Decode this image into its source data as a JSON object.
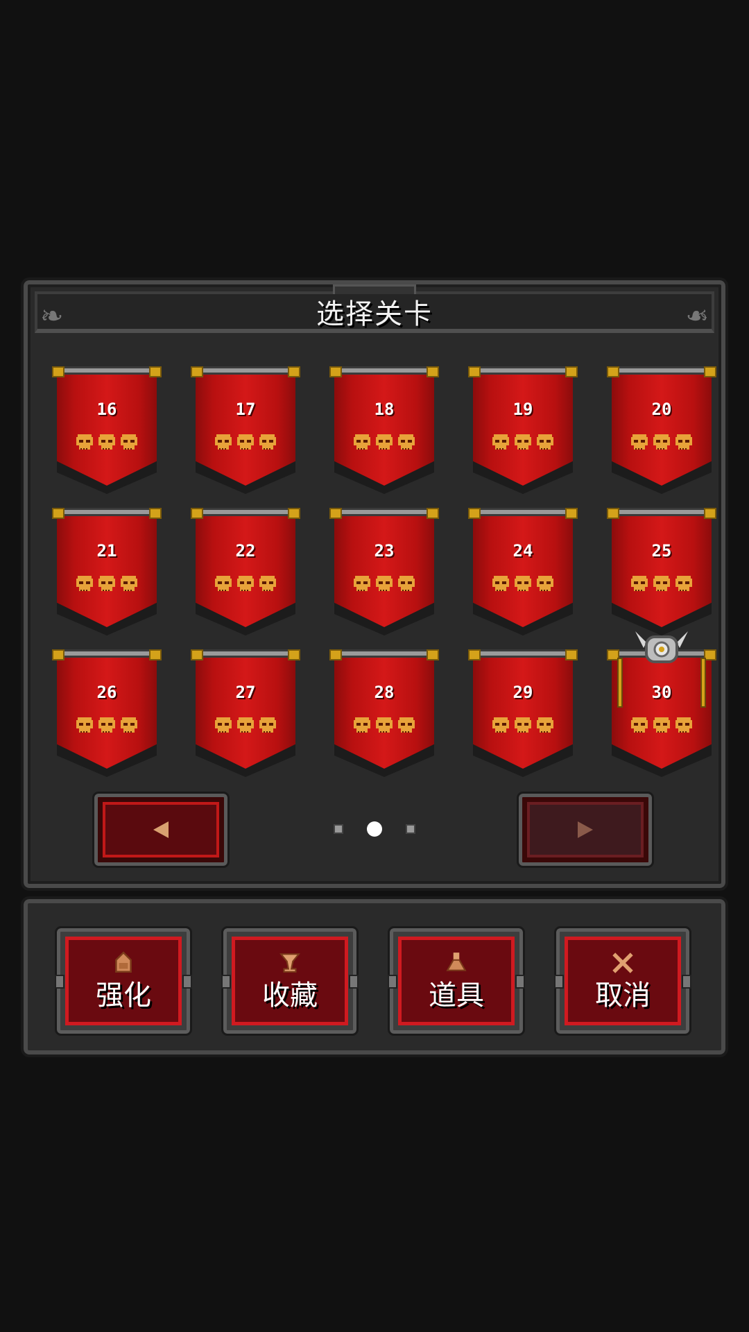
{
  "title": "选择关卡",
  "levels": [
    {
      "number": "16",
      "skulls": 3,
      "boss": false
    },
    {
      "number": "17",
      "skulls": 3,
      "boss": false
    },
    {
      "number": "18",
      "skulls": 3,
      "boss": false
    },
    {
      "number": "19",
      "skulls": 3,
      "boss": false
    },
    {
      "number": "20",
      "skulls": 3,
      "boss": false
    },
    {
      "number": "21",
      "skulls": 3,
      "boss": false
    },
    {
      "number": "22",
      "skulls": 3,
      "boss": false
    },
    {
      "number": "23",
      "skulls": 3,
      "boss": false
    },
    {
      "number": "24",
      "skulls": 3,
      "boss": false
    },
    {
      "number": "25",
      "skulls": 3,
      "boss": false
    },
    {
      "number": "26",
      "skulls": 3,
      "boss": false
    },
    {
      "number": "27",
      "skulls": 3,
      "boss": false
    },
    {
      "number": "28",
      "skulls": 3,
      "boss": false
    },
    {
      "number": "29",
      "skulls": 3,
      "boss": false
    },
    {
      "number": "30",
      "skulls": 3,
      "boss": true
    }
  ],
  "pagination": {
    "pages": 3,
    "current": 2
  },
  "nav": {
    "prev_icon": "arrow-left-icon",
    "next_icon": "arrow-right-icon",
    "next_disabled": true
  },
  "actions": [
    {
      "label": "强化",
      "icon": "upgrade-icon"
    },
    {
      "label": "收藏",
      "icon": "trophy-icon"
    },
    {
      "label": "道具",
      "icon": "potion-icon"
    },
    {
      "label": "取消",
      "icon": "close-icon"
    }
  ],
  "colors": {
    "banner_red": "#d41818",
    "skull_gold": "#e8a33a",
    "pole_gold": "#d4a21a",
    "panel": "#2a2a2a"
  }
}
